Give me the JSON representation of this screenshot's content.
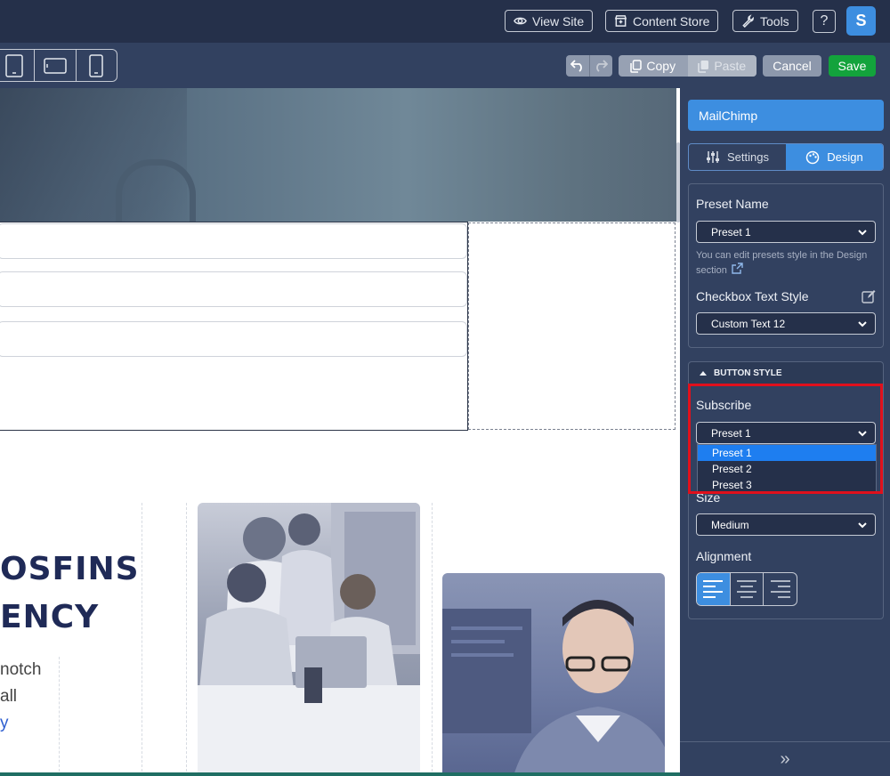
{
  "topbar": {
    "view_site": "View Site",
    "content_store": "Content Store",
    "tools": "Tools",
    "help": "?",
    "avatar_letter": "S"
  },
  "toolbar": {
    "devices": [
      "tablet-portrait-icon",
      "tablet-landscape-icon",
      "mobile-icon"
    ],
    "copy": "Copy",
    "paste": "Paste",
    "cancel": "Cancel",
    "save": "Save"
  },
  "canvas": {
    "heading_line1": "OSFINS",
    "heading_line2": "ENCY",
    "para_line1": "notch",
    "para_line2": "all",
    "para_line3": "y"
  },
  "panel": {
    "title": "MailChimp",
    "tabs": [
      {
        "label": "Settings",
        "icon": "sliders-icon",
        "active": false
      },
      {
        "label": "Design",
        "icon": "palette-icon",
        "active": true
      }
    ],
    "preset_name_label": "Preset Name",
    "preset_name_value": "Preset 1",
    "hint": "You can edit presets style in the Design section",
    "checkbox_text_style_label": "Checkbox Text Style",
    "checkbox_text_style_value": "Custom Text 12",
    "button_style_header": "BUTTON STYLE",
    "subscribe_label": "Subscribe",
    "subscribe_value": "Preset 1",
    "subscribe_options": [
      "Preset 1",
      "Preset 2",
      "Preset 3"
    ],
    "size_label": "Size",
    "size_value": "Medium",
    "alignment_label": "Alignment",
    "footer_icon": "»",
    "colors": {
      "accent": "#3d8ee0",
      "save": "#13a33c",
      "highlight": "#e0101c"
    }
  }
}
